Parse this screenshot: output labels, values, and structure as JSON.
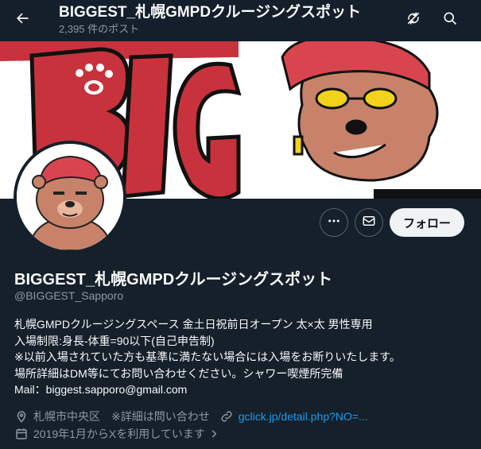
{
  "header": {
    "title": "BIGGEST_札幌GMPDクルージングスポット",
    "post_count": "2,395 件のポスト"
  },
  "banner": {
    "text": "BIG",
    "colors": {
      "red": "#c8323c",
      "skin": "#c8826a",
      "cap": "#d9454f",
      "yellow": "#f2d21a"
    }
  },
  "actions": {
    "follow_label": "フォロー"
  },
  "profile": {
    "display_name": "BIGGEST_札幌GMPDクルージングスポット",
    "handle": "@BIGGEST_Sapporo",
    "bio_lines": [
      "札幌GMPDクルージングスペース 金土日祝前日オープン 太×太 男性専用",
      "入場制限:身長-体重=90以下(自己申告制)",
      " ※以前入場されていた方も基準に満たない場合には入場をお断りいたします。",
      "場所詳細はDM等にてお問い合わせください。シャワー喫煙所完備",
      "Mail：biggest.sapporo@gmail.com"
    ],
    "location": "札幌市中央区　※詳細は問い合わせ",
    "url": "gclick.jp/detail.php?NO=...",
    "joined": "2019年1月からXを利用しています"
  },
  "icons": {
    "back": "arrow-left-icon",
    "nosync": "no-sync-icon",
    "search": "search-icon",
    "more": "more-icon",
    "mail": "mail-icon",
    "location": "location-pin-icon",
    "link": "link-icon",
    "calendar": "calendar-icon"
  },
  "colors": {
    "background": "#15202b",
    "text": "#f7f9f9",
    "secondary": "#8b98a5",
    "link": "#1d9bf0"
  }
}
